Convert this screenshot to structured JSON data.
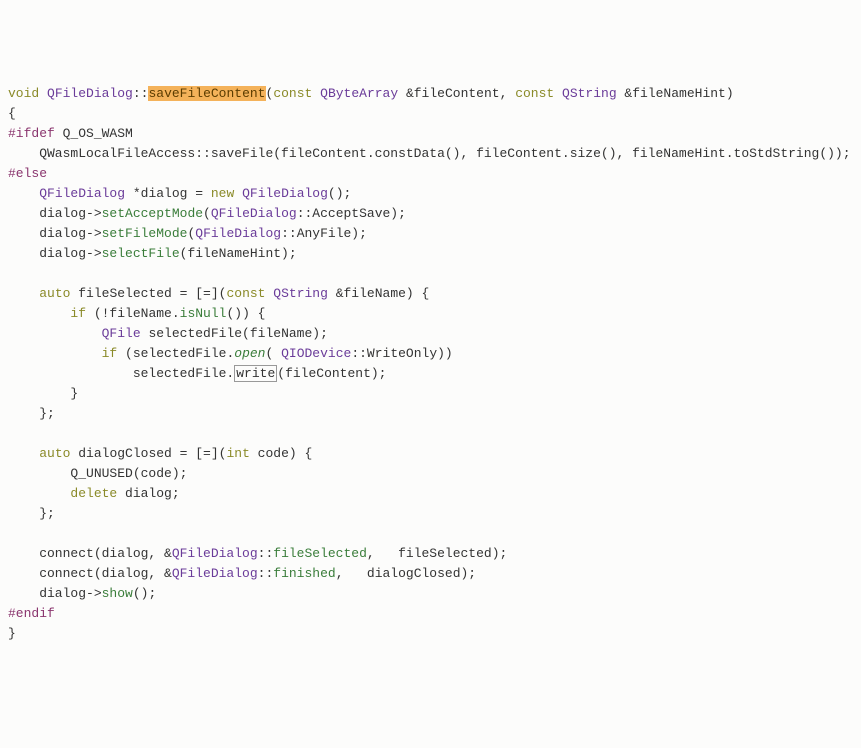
{
  "l1": {
    "a": "void",
    "b": "QFileDialog",
    "c": "::",
    "hl": "saveFileContent",
    "d": "(",
    "e": "const",
    "f": "QByteArray",
    "g": " &fileContent, ",
    "h": "const",
    "i": "QString",
    "j": " &fileNameHint)"
  },
  "l2": "{",
  "l3": {
    "a": "#ifdef",
    "b": " Q_OS_WASM"
  },
  "l4": {
    "a": "    QWasmLocalFileAccess::saveFile(fileContent.constData(), fileContent.size(), fileNameHint.toStdString());"
  },
  "l5": "#else",
  "l6": {
    "a": "    ",
    "b": "QFileDialog",
    "c": " *dialog = ",
    "d": "new",
    "e": " ",
    "f": "QFileDialog",
    "g": "();"
  },
  "l7": {
    "a": "    dialog->",
    "b": "setAcceptMode",
    "c": "(",
    "d": "QFileDialog",
    "e": "::AcceptSave);"
  },
  "l8": {
    "a": "    dialog->",
    "b": "setFileMode",
    "c": "(",
    "d": "QFileDialog",
    "e": "::AnyFile);"
  },
  "l9": {
    "a": "    dialog->",
    "b": "selectFile",
    "c": "(fileNameHint);"
  },
  "l10": "",
  "l11": {
    "a": "    ",
    "b": "auto",
    "c": " fileSelected = [=](",
    "d": "const",
    "e": " ",
    "f": "QString",
    "g": " &fileName) {"
  },
  "l12": {
    "a": "        ",
    "b": "if",
    "c": " (!fileName.",
    "d": "isNull",
    "e": "()) {"
  },
  "l13": {
    "a": "            ",
    "b": "QFile",
    "c": " selectedFile(fileName);"
  },
  "l14": {
    "a": "            ",
    "b": "if",
    "c": " (selectedFile.",
    "d": "open",
    "e": "( ",
    "f": "QIODevice",
    "g": "::WriteOnly))"
  },
  "l15": {
    "a": "                selectedFile.",
    "b": "write",
    "c": "(fileContent);"
  },
  "l16": "        }",
  "l17": "    };",
  "l18": "",
  "l19": {
    "a": "    ",
    "b": "auto",
    "c": " dialogClosed = [=](",
    "d": "int",
    "e": " code) {"
  },
  "l20": "        Q_UNUSED(code);",
  "l21": {
    "a": "        ",
    "b": "delete",
    "c": " dialog;"
  },
  "l22": "    };",
  "l23": "",
  "l24": {
    "a": "    connect(dialog, &",
    "b": "QFileDialog",
    "c": "::",
    "d": "fileSelected",
    "e": ",   fileSelected);"
  },
  "l25": {
    "a": "    connect(dialog, &",
    "b": "QFileDialog",
    "c": "::",
    "d": "finished",
    "e": ",   dialogClosed);"
  },
  "l26": {
    "a": "    dialog->",
    "b": "show",
    "c": "();"
  },
  "l27": "#endif",
  "l28": "}"
}
